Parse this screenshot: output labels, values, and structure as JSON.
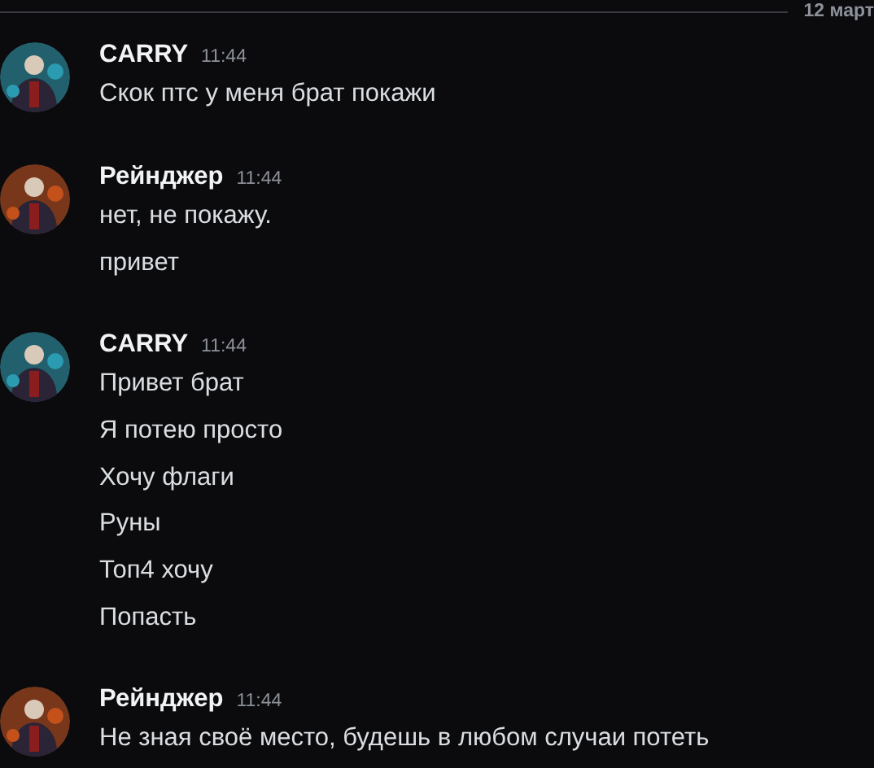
{
  "date_divider": "12 март",
  "groups": [
    {
      "author": "CARRY",
      "time": "11:44",
      "color": "#2a9bb0",
      "messages": [
        "Скок птс у меня брат покажи"
      ]
    },
    {
      "author": "Рейнджер",
      "time": "11:44",
      "color": "#c4501a",
      "messages": [
        "нет, не покажу.",
        "привет"
      ]
    },
    {
      "author": "CARRY",
      "time": "11:44",
      "color": "#2a9bb0",
      "messages": [
        "Привет брат",
        "Я потею просто",
        "Хочу флаги",
        "Руны",
        "Топ4 хочу",
        "Попасть"
      ]
    },
    {
      "author": "Рейнджер",
      "time": "11:44",
      "color": "#c4501a",
      "messages": [
        "Не зная своё место, будешь в любом случаи потеть"
      ]
    }
  ]
}
